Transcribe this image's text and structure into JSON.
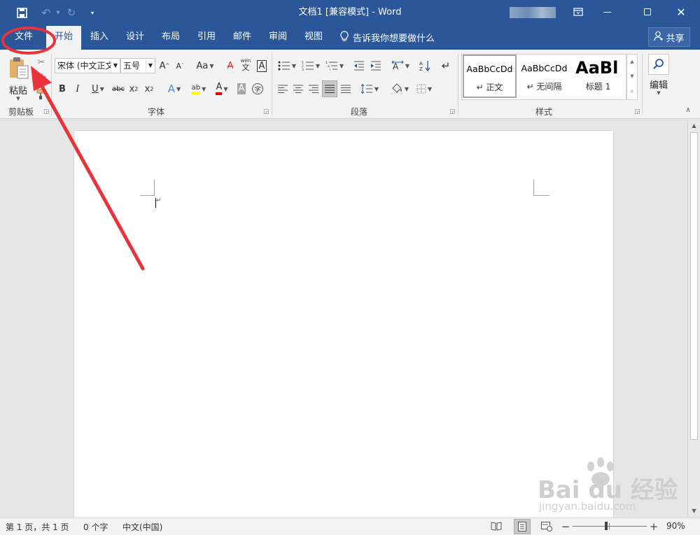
{
  "colors": {
    "accent": "#2b579a",
    "annotation_red": "#e8333a",
    "ribbon_bg": "#f3f3f3",
    "font_color_red": "#e00000",
    "highlight_yellow": "#ffff00"
  },
  "titlebar": {
    "title": "文档1 [兼容模式] - Word"
  },
  "tabs": [
    {
      "label": "文件"
    },
    {
      "label": "开始"
    },
    {
      "label": "插入"
    },
    {
      "label": "设计"
    },
    {
      "label": "布局"
    },
    {
      "label": "引用"
    },
    {
      "label": "邮件"
    },
    {
      "label": "审阅"
    },
    {
      "label": "视图"
    }
  ],
  "tell_me": {
    "label": "告诉我你想要做什么"
  },
  "share": {
    "label": "共享"
  },
  "ribbon": {
    "clipboard": {
      "paste_label": "粘贴",
      "group_label": "剪贴板"
    },
    "font": {
      "font_name": "宋体 (中文正文",
      "font_size": "五号",
      "group_label": "字体",
      "grow": "A",
      "shrink": "A",
      "case": "Aa",
      "clear": "A",
      "phonetic_top": "wén",
      "phonetic_bottom": "文",
      "border_char": "A",
      "bold": "B",
      "italic": "I",
      "underline": "U",
      "strike": "abc",
      "sub": "x",
      "sub_s": "2",
      "sup": "x",
      "sup_s": "2",
      "effects": "A",
      "highlight": "ab",
      "color": "A",
      "shade": "A",
      "enclose": "字"
    },
    "paragraph": {
      "group_label": "段落"
    },
    "styles": {
      "group_label": "样式",
      "items": [
        {
          "preview": "AaBbCcDd",
          "name": "↵ 正文"
        },
        {
          "preview": "AaBbCcDd",
          "name": "↵ 无间隔"
        },
        {
          "preview": "AaBl",
          "name": "标题 1"
        }
      ]
    },
    "editing": {
      "label": "编辑"
    }
  },
  "document": {
    "paragraph_mark": "↵"
  },
  "statusbar": {
    "page": "第 1 页，共 1 页",
    "words": "0 个字",
    "language": "中文(中国)",
    "zoom_minus": "−",
    "zoom_plus": "+",
    "zoom": "90%"
  },
  "watermark": {
    "brand": "Bai du 经验",
    "url": "jingyan.baidu.com"
  }
}
